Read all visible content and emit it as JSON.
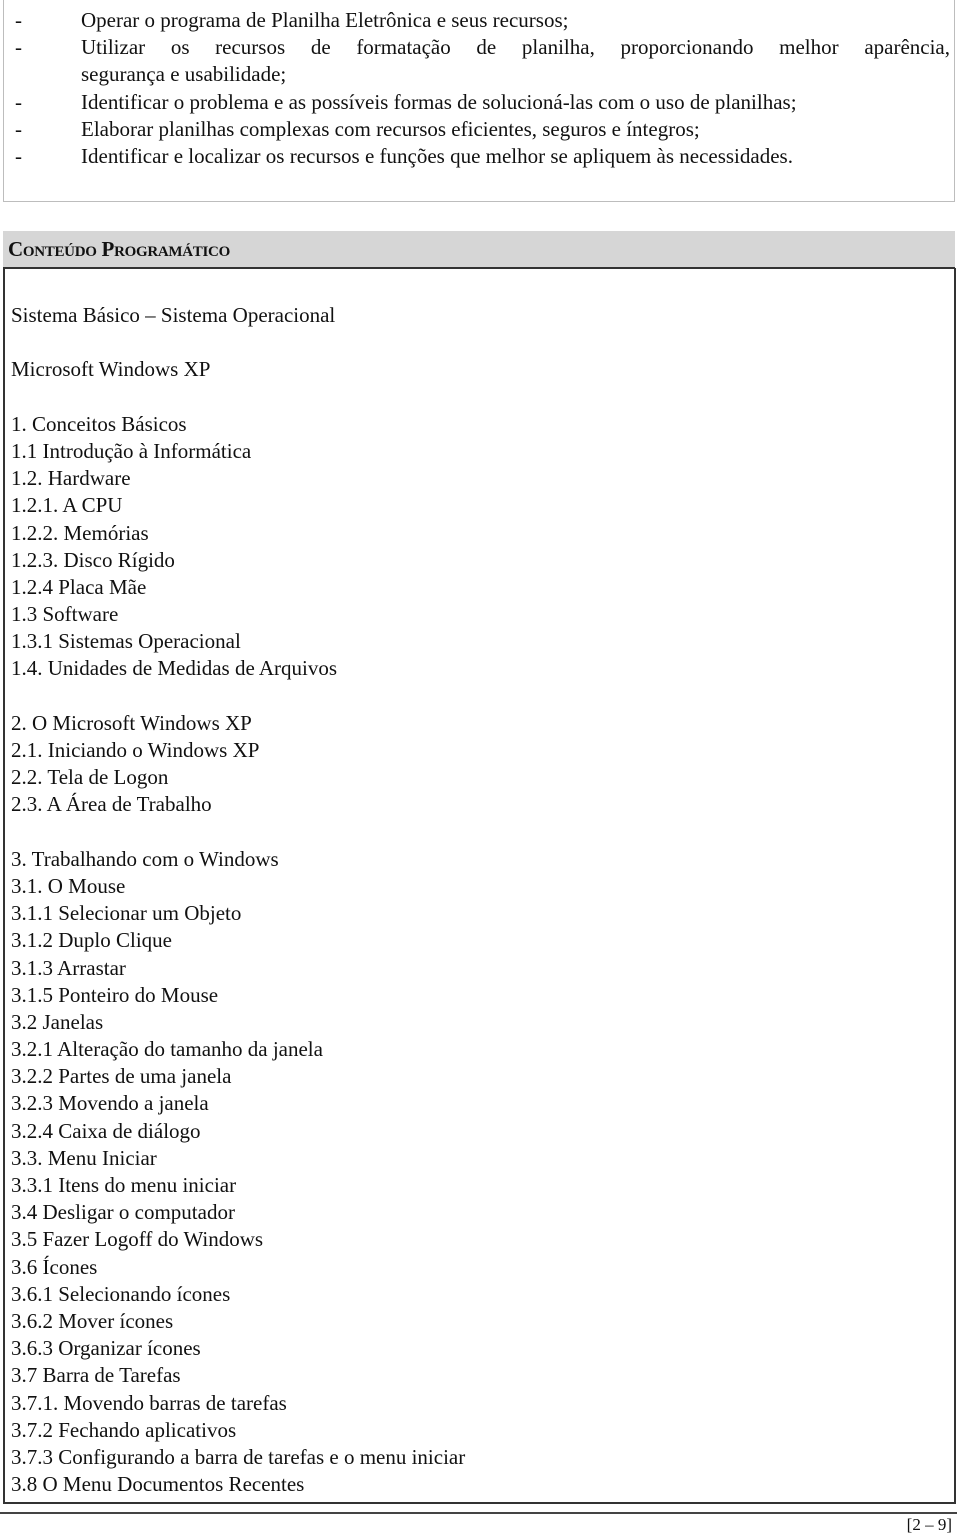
{
  "objectives": [
    {
      "bullet": "-",
      "lines": [
        "Operar o programa de Planilha Eletrônica e seus recursos;"
      ]
    },
    {
      "bullet": "-",
      "lines": [
        "Utilizar os recursos de formatação de planilha, proporcionando melhor aparência,",
        "segurança e usabilidade;"
      ]
    },
    {
      "bullet": "-",
      "lines": [
        "Identificar o problema e as possíveis formas de solucioná-las com o uso de planilhas;"
      ]
    },
    {
      "bullet": "-",
      "lines": [
        "Elaborar planilhas complexas com recursos eficientes, seguros e íntegros;"
      ]
    },
    {
      "bullet": "-",
      "lines": [
        "Identificar e localizar os recursos e funções que melhor se apliquem às necessidades."
      ]
    }
  ],
  "section": {
    "title": "Conteúdo Programático",
    "lines": [
      "Sistema Básico – Sistema Operacional",
      "",
      "Microsoft Windows XP",
      "",
      "1. Conceitos Básicos",
      "1.1 Introdução à Informática",
      "1.2. Hardware",
      "1.2.1. A CPU",
      "1.2.2. Memórias",
      "1.2.3. Disco Rígido",
      "1.2.4 Placa Mãe",
      "1.3 Software",
      "1.3.1 Sistemas Operacional",
      "1.4. Unidades de Medidas de Arquivos",
      "",
      "2. O Microsoft Windows XP",
      "2.1. Iniciando o Windows XP",
      "2.2. Tela de Logon",
      "2.3. A Área de Trabalho",
      "",
      "3. Trabalhando com o Windows",
      "3.1. O Mouse",
      "3.1.1 Selecionar um Objeto",
      "3.1.2 Duplo Clique",
      "3.1.3 Arrastar",
      "3.1.5 Ponteiro do Mouse",
      "3.2 Janelas",
      "3.2.1 Alteração do tamanho da janela",
      "3.2.2 Partes de uma janela",
      "3.2.3 Movendo a janela",
      "3.2.4 Caixa de diálogo",
      "3.3. Menu Iniciar",
      "3.3.1 Itens do menu iniciar",
      "3.4 Desligar o computador",
      "3.5 Fazer Logoff do Windows",
      "3.6 Ícones",
      "3.6.1 Selecionando ícones",
      "3.6.2 Mover ícones",
      "3.6.3 Organizar ícones",
      "3.7 Barra de Tarefas",
      "3.7.1. Movendo barras de tarefas",
      "3.7.2 Fechando aplicativos",
      "3.7.3 Configurando a barra de tarefas e o menu iniciar",
      "3.8 O Menu Documentos Recentes"
    ]
  },
  "footer": {
    "page": "[2 – 9]"
  }
}
